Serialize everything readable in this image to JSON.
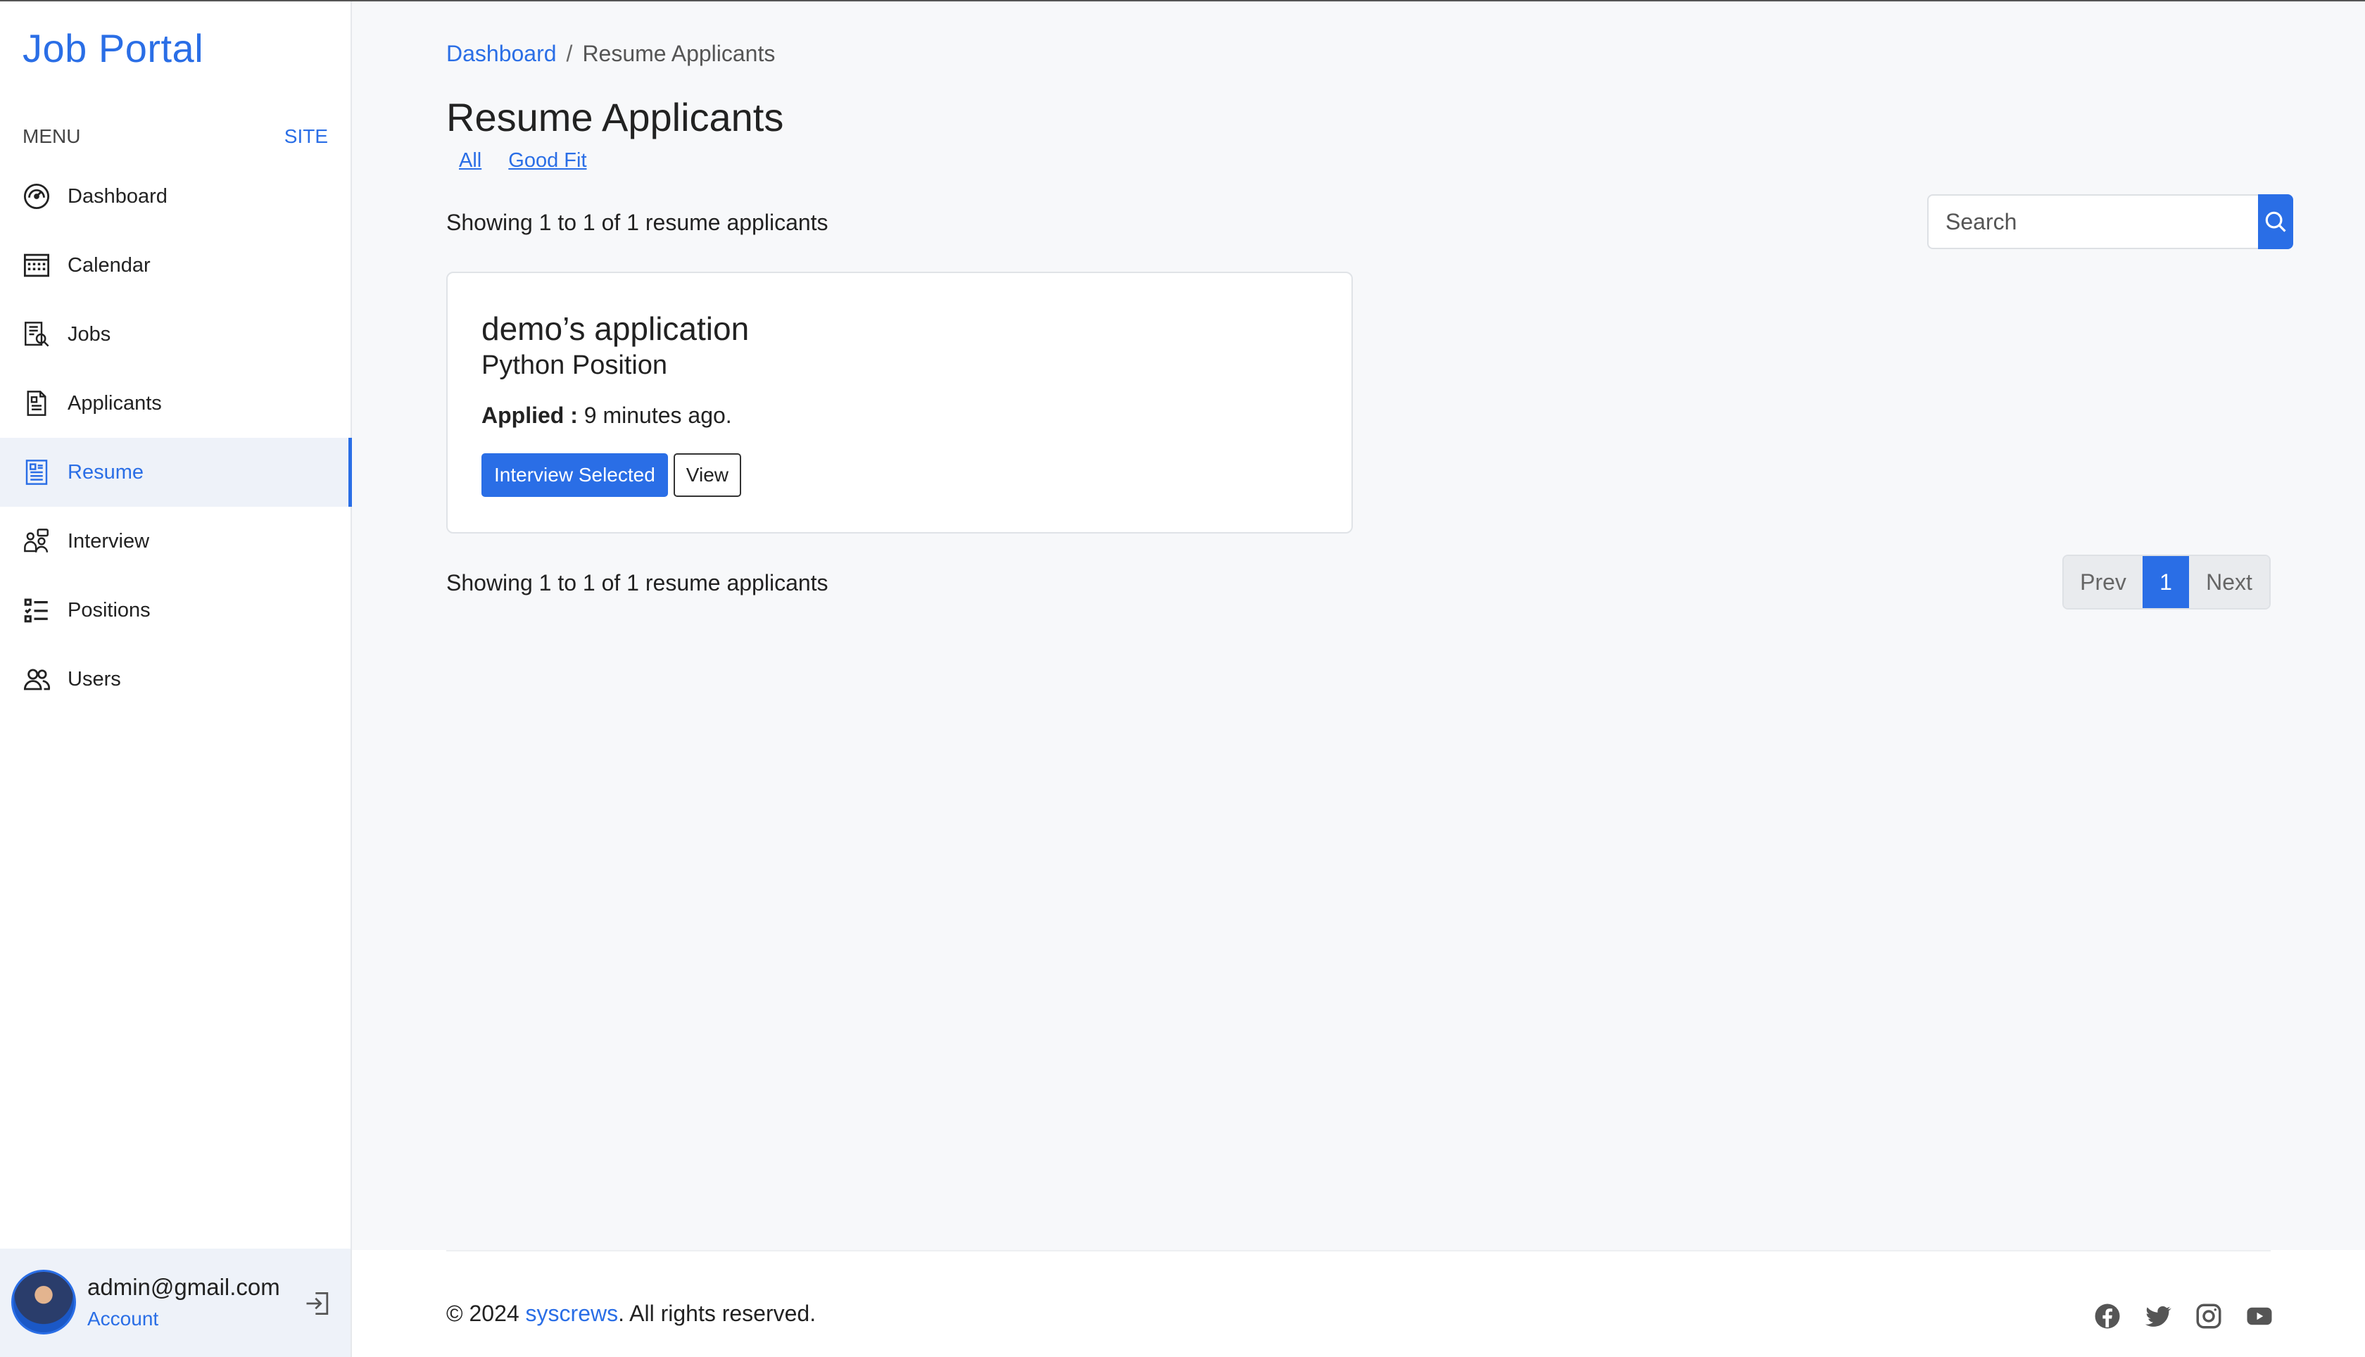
{
  "brand": "Job Portal",
  "sidebar": {
    "menu_label": "MENU",
    "site_label": "SITE",
    "items": [
      {
        "label": "Dashboard",
        "icon": "speedometer-icon"
      },
      {
        "label": "Calendar",
        "icon": "calendar-icon"
      },
      {
        "label": "Jobs",
        "icon": "jobs-search-icon"
      },
      {
        "label": "Applicants",
        "icon": "document-icon"
      },
      {
        "label": "Resume",
        "icon": "resume-icon",
        "active": true
      },
      {
        "label": "Interview",
        "icon": "interview-icon"
      },
      {
        "label": "Positions",
        "icon": "checklist-icon"
      },
      {
        "label": "Users",
        "icon": "users-icon"
      }
    ]
  },
  "account": {
    "email": "admin@gmail.com",
    "label": "Account"
  },
  "breadcrumb": {
    "home": "Dashboard",
    "separator": "/",
    "current": "Resume Applicants"
  },
  "page": {
    "title": "Resume Applicants",
    "filters": [
      "All",
      "Good Fit"
    ],
    "showing_text": "Showing 1 to 1 of 1 resume applicants"
  },
  "search": {
    "placeholder": "Search"
  },
  "applications": [
    {
      "title": "demo’s application",
      "position": "Python Position",
      "applied_label": "Applied :",
      "applied_time": "9 minutes ago.",
      "status_button": "Interview Selected",
      "view_button": "View"
    }
  ],
  "pagination": {
    "prev": "Prev",
    "current": "1",
    "next": "Next"
  },
  "footer": {
    "copyright_prefix": "© 2024 ",
    "company": "syscrews",
    "copyright_suffix": ". All rights reserved.",
    "socials": [
      "facebook-icon",
      "twitter-icon",
      "instagram-icon",
      "youtube-icon"
    ]
  },
  "colors": {
    "accent": "#2a6ee6",
    "background": "#f7f8fa",
    "active_bg": "#eef2f9"
  }
}
